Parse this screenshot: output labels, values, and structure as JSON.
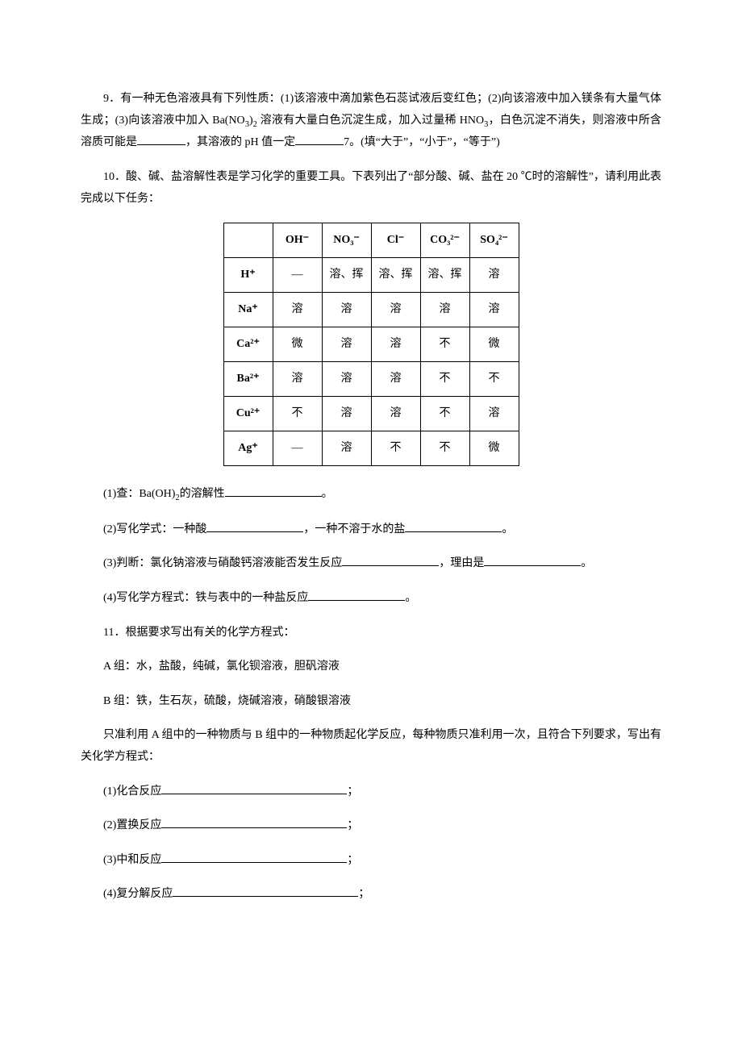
{
  "q9": {
    "text_a": "9．有一种无色溶液具有下列性质：(1)该溶液中滴加紫色石蕊试液后变红色；(2)向该溶液中加入镁条有大量气体生成；(3)向该溶液中加入 Ba(NO",
    "text_b": "溶液有大量白色沉淀生成，加入过量稀 HNO",
    "text_c": "，白色沉淀不消失，则溶液中所含溶质可能是",
    "text_d": "，其溶液的 pH 值一定",
    "text_e": "7。(填“大于”，“小于”，“等于”)",
    "sub_3_2": "3",
    "sub_2": "2",
    "sub_3": "3"
  },
  "q10": {
    "intro": "10．酸、碱、盐溶解性表是学习化学的重要工具。下表列出了“部分酸、碱、盐在 20 ℃时的溶解性”，请利用此表完成以下任务：",
    "table": {
      "headers": [
        "",
        "OH⁻",
        "NO₃⁻",
        "Cl⁻",
        "CO₃²⁻",
        "SO₄²⁻"
      ],
      "rows": [
        {
          "ion": "H⁺",
          "cells": [
            "—",
            "溶、挥",
            "溶、挥",
            "溶、挥",
            "溶"
          ]
        },
        {
          "ion": "Na⁺",
          "cells": [
            "溶",
            "溶",
            "溶",
            "溶",
            "溶"
          ]
        },
        {
          "ion": "Ca²⁺",
          "cells": [
            "微",
            "溶",
            "溶",
            "不",
            "微"
          ]
        },
        {
          "ion": "Ba²⁺",
          "cells": [
            "溶",
            "溶",
            "溶",
            "不",
            "不"
          ]
        },
        {
          "ion": "Cu²⁺",
          "cells": [
            "不",
            "溶",
            "溶",
            "不",
            "溶"
          ]
        },
        {
          "ion": "Ag⁺",
          "cells": [
            "—",
            "溶",
            "不",
            "不",
            "微"
          ]
        }
      ]
    },
    "p1_a": "(1)查：Ba(OH)",
    "p1_sub": "2",
    "p1_b": "的溶解性",
    "p1_c": "。",
    "p2_a": "(2)写化学式：一种酸",
    "p2_b": "，一种不溶于水的盐",
    "p2_c": "。",
    "p3_a": "(3)判断：氯化钠溶液与硝酸钙溶液能否发生反应",
    "p3_b": "，理由是",
    "p3_c": "。",
    "p4_a": "(4)写化学方程式：铁与表中的一种盐反应",
    "p4_b": "。"
  },
  "q11": {
    "intro": "11．根据要求写出有关的化学方程式：",
    "groupA": "A 组：水，盐酸，纯碱，氯化钡溶液，胆矾溶液",
    "groupB": "B 组：铁，生石灰，硫酸，烧碱溶液，硝酸银溶液",
    "cond": "只准利用 A 组中的一种物质与 B 组中的一种物质起化学反应，每种物质只准利用一次，且符合下列要求，写出有关化学方程式：",
    "i1": "(1)化合反应",
    "i2": "(2)置换反应",
    "i3": "(3)中和反应",
    "i4": "(4)复分解反应",
    "semi": "；"
  }
}
